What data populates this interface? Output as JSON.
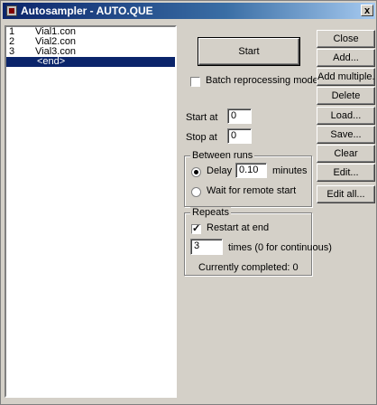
{
  "window": {
    "title": "Autosampler - AUTO.QUE",
    "close_glyph": "x"
  },
  "queue": {
    "items": [
      {
        "num": "1",
        "file": "Vial1.con"
      },
      {
        "num": "2",
        "file": "Vial2.con"
      },
      {
        "num": "3",
        "file": "Vial3.con"
      }
    ],
    "end_marker": "<end>"
  },
  "controls": {
    "start_label": "Start",
    "batch_label": "Batch reprocessing mode",
    "batch_checked": false,
    "start_at_label": "Start at",
    "start_at_value": "0",
    "stop_at_label": "Stop at",
    "stop_at_value": "0"
  },
  "between_runs": {
    "title": "Between runs",
    "delay_label": "Delay",
    "delay_value": "0.10",
    "delay_unit": "minutes",
    "wait_label": "Wait for remote start",
    "selected": "delay"
  },
  "repeats": {
    "title": "Repeats",
    "restart_label": "Restart at end",
    "restart_checked": true,
    "times_value": "3",
    "times_label": "times (0 for continuous)",
    "completed_text": "Currently completed: 0"
  },
  "side_buttons": {
    "close": "Close",
    "add": "Add...",
    "add_multiple": "Add multiple...",
    "delete": "Delete",
    "load": "Load...",
    "save": "Save...",
    "clear": "Clear",
    "edit": "Edit...",
    "edit_all": "Edit all..."
  }
}
